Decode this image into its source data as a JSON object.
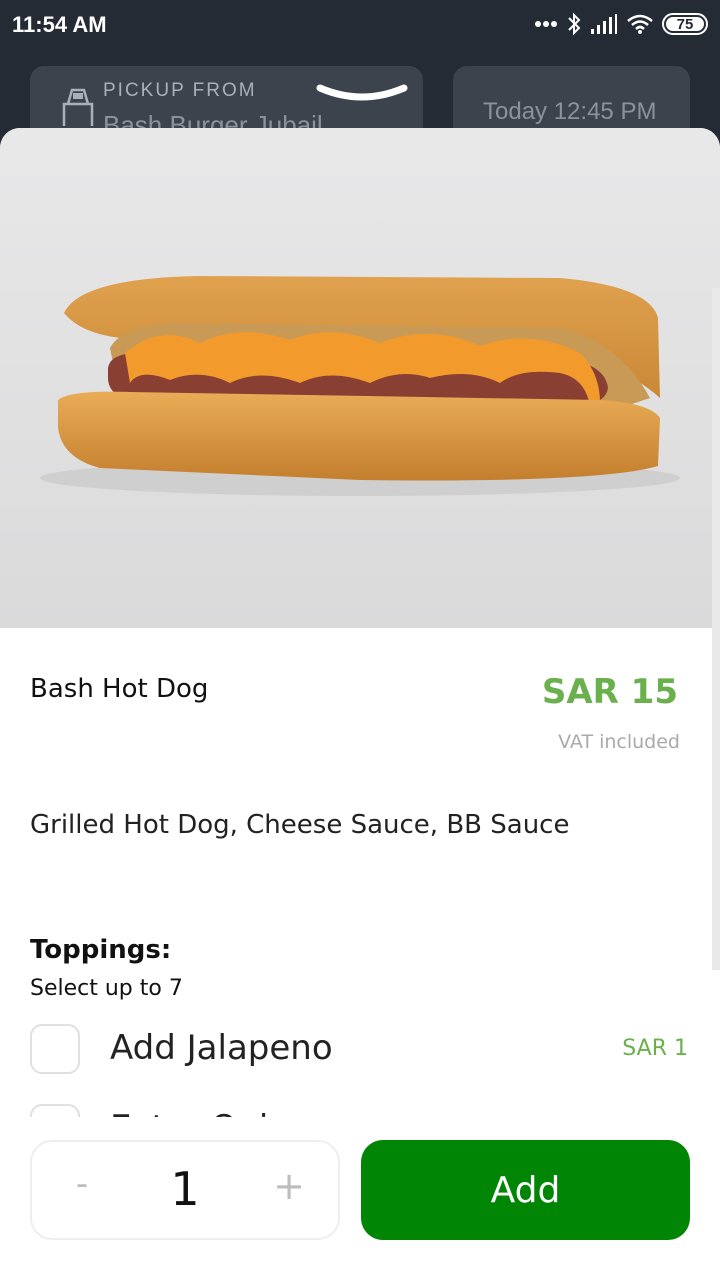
{
  "status_bar": {
    "time": "11:54 AM",
    "battery": "75"
  },
  "header": {
    "pickup_label": "PICKUP FROM",
    "branch": "Bash Burger Jubail",
    "pickup_time": "Today 12:45 PM"
  },
  "item": {
    "name": "Bash Hot Dog",
    "price": "SAR 15",
    "vat_note": "VAT included",
    "description": "Grilled Hot Dog, Cheese Sauce, BB Sauce"
  },
  "toppings": {
    "title": "Toppings:",
    "subtitle": "Select up to 7",
    "items": [
      {
        "label": "Add Jalapeno",
        "price": "SAR 1"
      },
      {
        "label": "Extra Onion",
        "price": ""
      }
    ]
  },
  "footer": {
    "minus": "-",
    "quantity": "1",
    "plus": "+",
    "add_label": "Add"
  },
  "colors": {
    "accent_green": "#6ab04c",
    "add_button": "#008505",
    "header_bg": "#252b35"
  }
}
